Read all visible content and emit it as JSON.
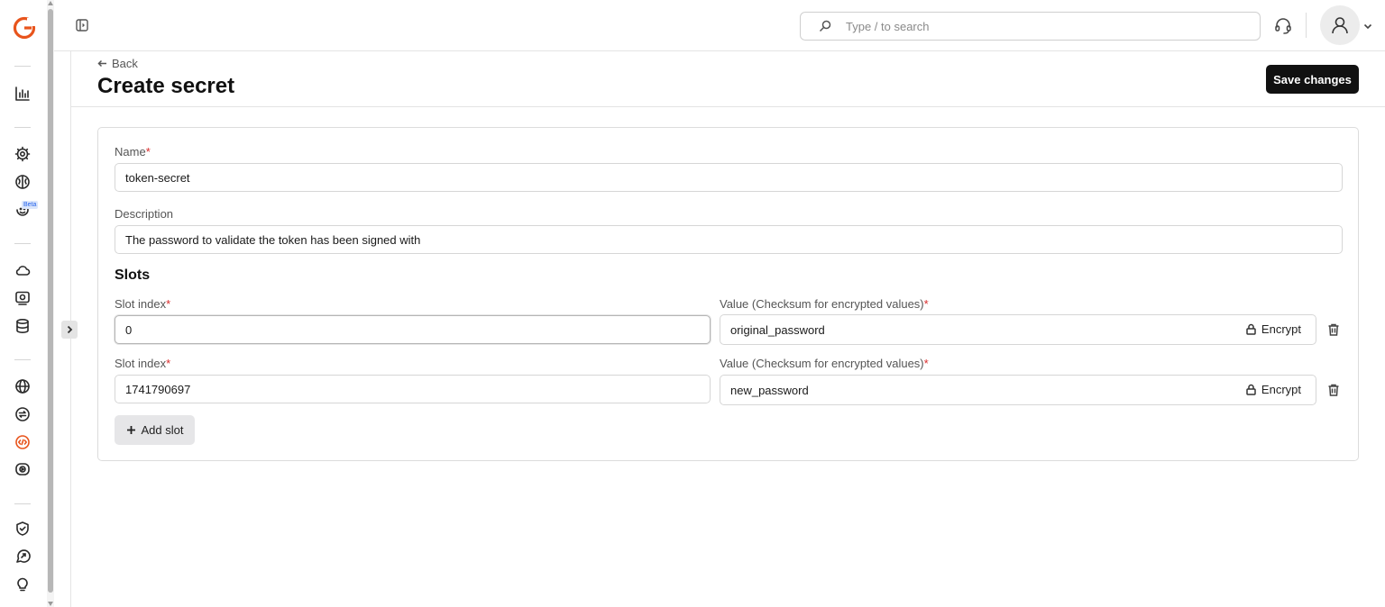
{
  "header": {
    "search_placeholder": "Type / to search"
  },
  "rail": {
    "beta_label": "Beta"
  },
  "page": {
    "back_label": "Back",
    "title": "Create secret",
    "save_label": "Save changes"
  },
  "form": {
    "name_label": "Name",
    "name_value": "token-secret",
    "description_label": "Description",
    "description_value": "The password to validate the token has been signed with",
    "slots_title": "Slots",
    "required_mark": "*",
    "slot_index_label": "Slot index",
    "value_label": "Value (Checksum for encrypted values)",
    "encrypt_label": "Encrypt",
    "add_slot_label": "Add slot",
    "slots": [
      {
        "index": "0",
        "value": "original_password"
      },
      {
        "index": "1741790697",
        "value": "new_password"
      }
    ]
  },
  "colors": {
    "accent": "#e8541c",
    "primary_button": "#111111",
    "required": "#d92b2b"
  }
}
